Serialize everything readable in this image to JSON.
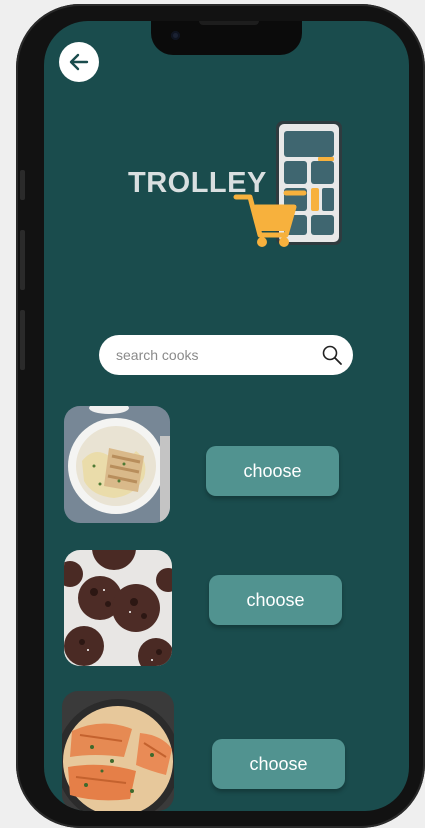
{
  "header": {
    "back_icon": "arrow-left-icon"
  },
  "logo": {
    "text": "TROLLEY",
    "icon": "phone-with-cart-icon"
  },
  "search": {
    "placeholder": "search cooks",
    "value": "",
    "icon": "search-icon"
  },
  "recipes": [
    {
      "image": "creamy-chicken-pasta-photo",
      "button_label": "choose"
    },
    {
      "image": "chocolate-cookies-photo",
      "button_label": "choose"
    },
    {
      "image": "creamy-salmon-skillet-photo",
      "button_label": "choose"
    }
  ],
  "colors": {
    "screen_bg": "#1a4c4d",
    "button_bg": "#519390",
    "cart_orange": "#f7b13d",
    "phone_tile": "#3f6670"
  }
}
